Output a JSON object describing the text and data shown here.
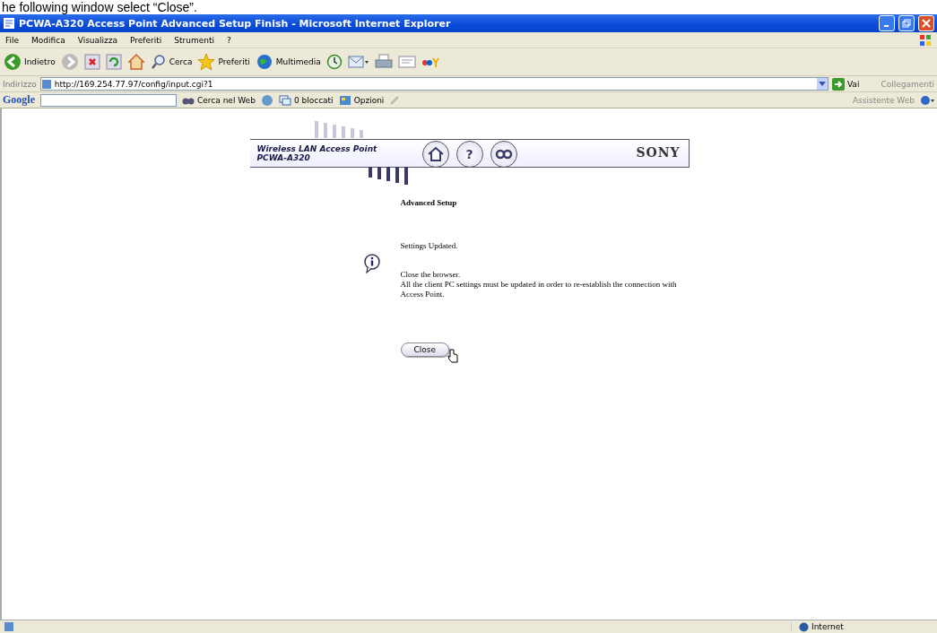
{
  "caption": "he following window select “Close”.",
  "window": {
    "title": "PCWA-A320 Access Point Advanced Setup Finish - Microsoft Internet Explorer"
  },
  "menu": [
    "File",
    "Modifica",
    "Visualizza",
    "Preferiti",
    "Strumenti",
    "?"
  ],
  "toolbar": [
    {
      "kind": "back",
      "label": "Indietro"
    },
    {
      "kind": "forward"
    },
    {
      "kind": "stop"
    },
    {
      "kind": "refresh"
    },
    {
      "kind": "home"
    },
    {
      "kind": "search",
      "label": "Cerca"
    },
    {
      "kind": "favorites",
      "label": "Preferiti"
    },
    {
      "kind": "media",
      "label": "Multimedia"
    },
    {
      "kind": "history"
    },
    {
      "kind": "mail"
    },
    {
      "kind": "print"
    },
    {
      "kind": "edit"
    },
    {
      "kind": "logo"
    }
  ],
  "address": {
    "label": "Indirizzo",
    "url": "http://169.254.77.97/config/input.cgi?1",
    "go": "Vai",
    "links": "Collegamenti"
  },
  "google_toolbar": {
    "logo": "Google",
    "search_web": "Cerca nel Web",
    "blocked": "0 bloccati",
    "options": "Opzioni",
    "assistant": "Assistente Web"
  },
  "page": {
    "product": "Wireless LAN Access Point",
    "model": "PCWA-A320",
    "brand": "SONY",
    "nav": [
      {
        "kind": "home"
      },
      {
        "kind": "text",
        "label": "?"
      },
      {
        "kind": "link"
      }
    ],
    "heading": "Advanced Setup",
    "message": "Settings Updated.",
    "paragraphs": [
      "Close the browser.",
      "All the client PC settings must be updated in order to re-establish the connection with Access Point."
    ],
    "button": "Close"
  },
  "status_bar": {
    "zone": "Internet"
  }
}
